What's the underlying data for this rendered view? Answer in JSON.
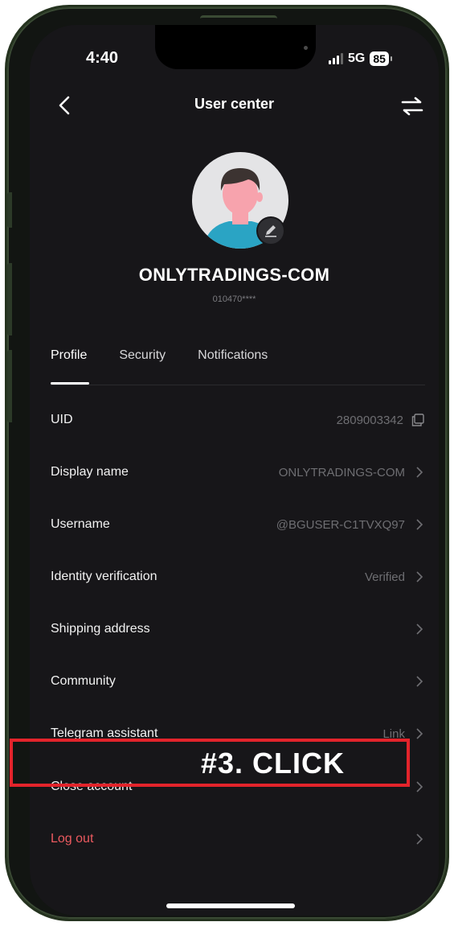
{
  "status_bar": {
    "time": "4:40",
    "network": "5G",
    "battery": "85"
  },
  "header": {
    "title": "User center"
  },
  "profile": {
    "username": "ONLYTRADINGS-COM",
    "account_number": "010470****"
  },
  "tabs": [
    {
      "label": "Profile",
      "active": true
    },
    {
      "label": "Security",
      "active": false
    },
    {
      "label": "Notifications",
      "active": false
    }
  ],
  "rows": [
    {
      "label": "UID",
      "value": "2809003342"
    },
    {
      "label": "Display name",
      "value": "ONLYTRADINGS-COM"
    },
    {
      "label": "Username",
      "value": "@BGUSER-C1TVXQ97"
    },
    {
      "label": "Identity verification",
      "value": "Verified"
    },
    {
      "label": "Shipping address",
      "value": ""
    },
    {
      "label": "Community",
      "value": ""
    },
    {
      "label": "Telegram assistant",
      "value": "Link"
    },
    {
      "label": "Close account",
      "value": ""
    },
    {
      "label": "Log out",
      "value": ""
    }
  ],
  "annotation": {
    "text": "#3. CLICK"
  },
  "colors": {
    "background": "#171619",
    "accent_red": "#e3242b",
    "logout_red": "#ec5a5f"
  },
  "icons": [
    "back-arrow-icon",
    "swap-icon",
    "edit-icon",
    "copy-icon",
    "chevron-right-icon"
  ]
}
